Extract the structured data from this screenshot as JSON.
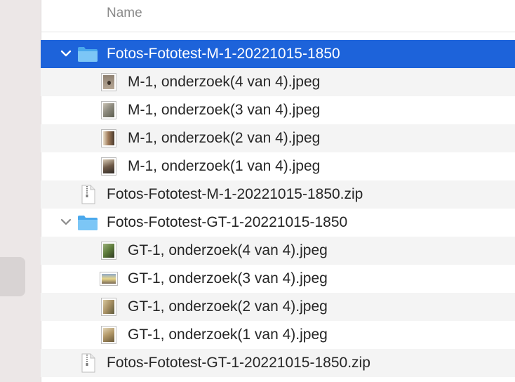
{
  "header": {
    "name_col": "Name"
  },
  "rows": [
    {
      "type": "folder",
      "label": "Fotos-Fototest-M-1-20221015-1850",
      "expanded": true,
      "selected": true
    },
    {
      "type": "image",
      "label": "M-1, onderzoek(4 van 4).jpeg"
    },
    {
      "type": "image",
      "label": "M-1, onderzoek(3 van 4).jpeg"
    },
    {
      "type": "image",
      "label": "M-1, onderzoek(2 van 4).jpeg"
    },
    {
      "type": "image",
      "label": "M-1, onderzoek(1 van 4).jpeg"
    },
    {
      "type": "zip",
      "label": "Fotos-Fototest-M-1-20221015-1850.zip"
    },
    {
      "type": "folder",
      "label": "Fotos-Fototest-GT-1-20221015-1850",
      "expanded": true,
      "selected": false
    },
    {
      "type": "image",
      "label": "GT-1, onderzoek(4 van 4).jpeg"
    },
    {
      "type": "image",
      "label": "GT-1, onderzoek(3 van 4).jpeg"
    },
    {
      "type": "image",
      "label": "GT-1, onderzoek(2 van 4).jpeg"
    },
    {
      "type": "image",
      "label": "GT-1, onderzoek(1 van 4).jpeg"
    },
    {
      "type": "zip",
      "label": "Fotos-Fototest-GT-1-20221015-1850.zip"
    }
  ],
  "colors": {
    "selection": "#1d63da",
    "folder": "#5ab7f2",
    "alt_row": "#f4f4f4"
  }
}
